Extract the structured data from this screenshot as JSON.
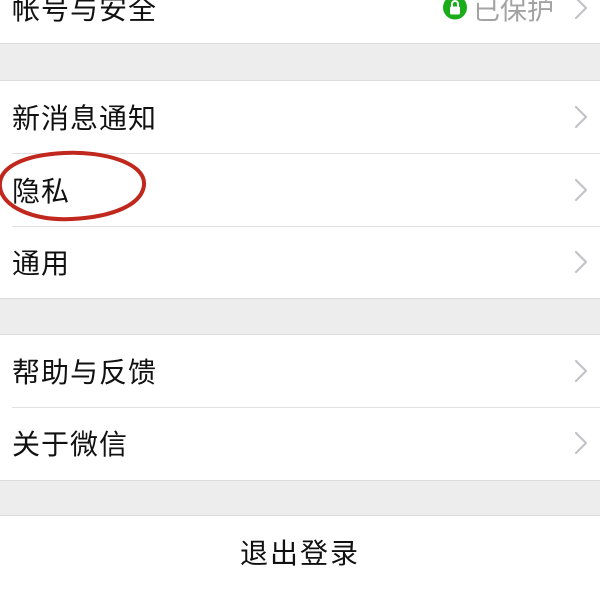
{
  "settings": {
    "account_security": {
      "label": "帐号与安全",
      "status": "已保护",
      "lock_icon": "lock-icon",
      "badge_color": "#1aad19"
    },
    "group_general": [
      {
        "label": "新消息通知"
      },
      {
        "label": "隐私"
      },
      {
        "label": "通用"
      }
    ],
    "group_help": [
      {
        "label": "帮助与反馈"
      },
      {
        "label": "关于微信"
      }
    ],
    "logout": {
      "label": "退出登录"
    }
  },
  "icons": {
    "chevron": "chevron-right-icon"
  },
  "annotation": {
    "color": "#c0271d",
    "target": "隐私"
  }
}
